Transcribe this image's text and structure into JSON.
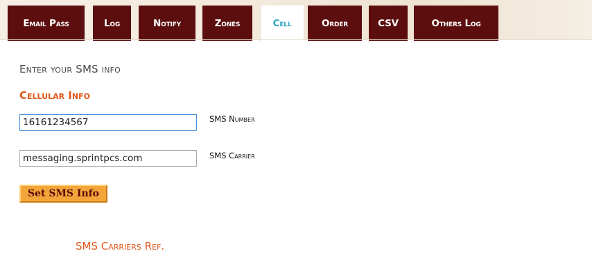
{
  "tabs": [
    {
      "label": "Email Pass",
      "active": false
    },
    {
      "label": "Log",
      "active": false
    },
    {
      "label": "Notify",
      "active": false
    },
    {
      "label": "Zones",
      "active": false
    },
    {
      "label": "Cell",
      "active": true
    },
    {
      "label": "Order",
      "active": false
    },
    {
      "label": "CSV",
      "active": false
    },
    {
      "label": "Others Log",
      "active": false
    }
  ],
  "main": {
    "heading": "Enter your SMS info",
    "section_title": "Cellular Info",
    "sms_number": {
      "value": "16161234567",
      "label": "SMS Number"
    },
    "sms_carrier": {
      "value": "messaging.sprintpcs.com",
      "label": "SMS Carrier"
    },
    "submit_label": "Set SMS Info",
    "carriers_ref_link": "SMS Carriers Ref."
  },
  "colors": {
    "tab_bg": "#5c0e0e",
    "tab_active_text": "#2aa6c4",
    "accent_orange": "#e0581c",
    "button_bg": "#f4a53a"
  }
}
